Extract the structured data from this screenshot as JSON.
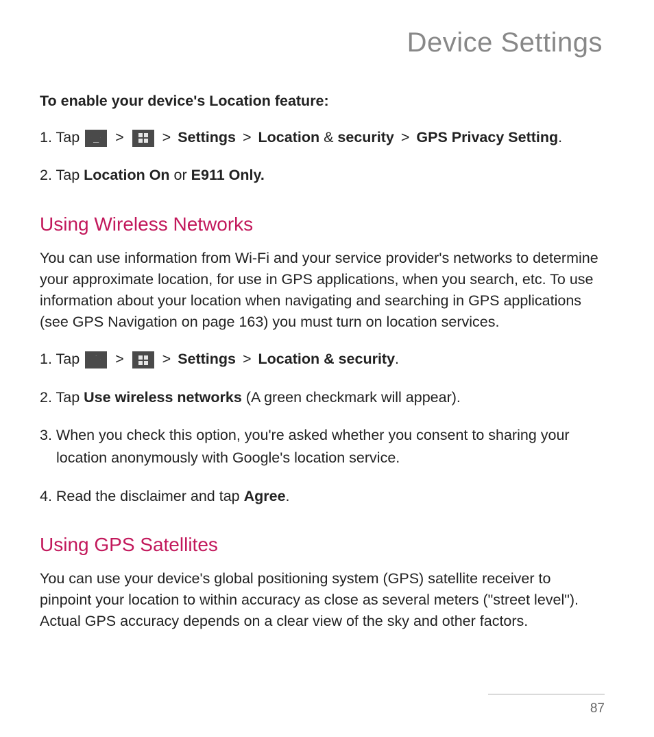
{
  "page_title": "Device Settings",
  "intro_heading": "To enable your device's Location feature:",
  "step1": {
    "prefix": "1. Tap ",
    "sep": " > ",
    "s1": "Settings",
    "s2": "Location",
    "amp": " & ",
    "s3": "security",
    "s4": "GPS Privacy Setting",
    "end": "."
  },
  "step2": {
    "prefix": "2. Tap ",
    "b1": "Location On",
    "mid": " or ",
    "b2": "E911 Only."
  },
  "section_wireless": {
    "heading": "Using Wireless Networks",
    "body": "You can use information from Wi-Fi and your service provider's networks to determine your approximate location, for use in GPS applications, when you search, etc. To use information about your location when navigating and searching in GPS applications (see GPS Navigation on page 163) you must turn on location services.",
    "w1": {
      "prefix": "1. Tap ",
      "sep": " > ",
      "s1": "Settings",
      "s2": "Location & security",
      "end": "."
    },
    "w2": {
      "prefix": "2. Tap ",
      "b1": "Use wireless networks",
      "rest": " (A green checkmark will appear)."
    },
    "w3": "3. When you check this option, you're asked whether you consent to sharing your location anonymously with Google's location service.",
    "w4": {
      "prefix": "4. Read the disclaimer and tap ",
      "b1": "Agree",
      "end": "."
    }
  },
  "section_gps": {
    "heading": "Using GPS Satellites",
    "body": "You can use your device's global positioning system (GPS) satellite receiver to pinpoint your location to within accuracy as close as several meters (\"street level\"). Actual GPS accuracy depends on a clear view of the sky and other factors."
  },
  "page_number": "87"
}
